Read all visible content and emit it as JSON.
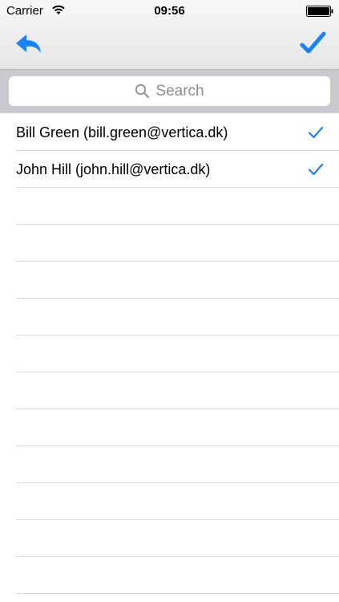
{
  "status_bar": {
    "carrier": "Carrier",
    "time": "09:56",
    "wifi_icon": "wifi-icon",
    "battery_icon": "battery-full-icon"
  },
  "nav": {
    "left_icon": "reply-back-icon",
    "right_icon": "checkmark-icon",
    "accent_color": "#1a82fb"
  },
  "search": {
    "placeholder": "Search",
    "icon": "search-icon"
  },
  "list": {
    "items": [
      {
        "label": "Bill Green (bill.green@vertica.dk)",
        "selected": true
      },
      {
        "label": "John Hill (john.hill@vertica.dk)",
        "selected": true
      }
    ]
  }
}
